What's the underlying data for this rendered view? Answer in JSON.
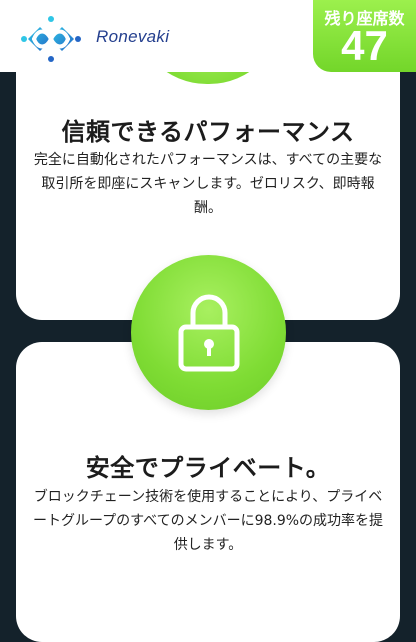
{
  "header": {
    "brand": "Ronevaki",
    "logo_icon": "ronevaki-logo-icon",
    "seats_label": "残り座席数",
    "seats_count": "47"
  },
  "features": [
    {
      "title": "信頼できるパフォーマンス",
      "description": "完全に自動化されたパフォーマンスは、すべての主要な取引所を即座にスキャンします。ゼロリスク、即時報酬。"
    },
    {
      "icon": "padlock-icon",
      "title": "安全でプライベート。",
      "description": "ブロックチェーン技術を使用することにより、プライベートグループのすべてのメンバーに98.9%の成功率を提供します。"
    }
  ],
  "colors": {
    "accent_green": "#7fdc34",
    "brand_blue": "#243f8e",
    "logo_cyan": "#2bb8d8",
    "background_dark": "#14222b"
  }
}
